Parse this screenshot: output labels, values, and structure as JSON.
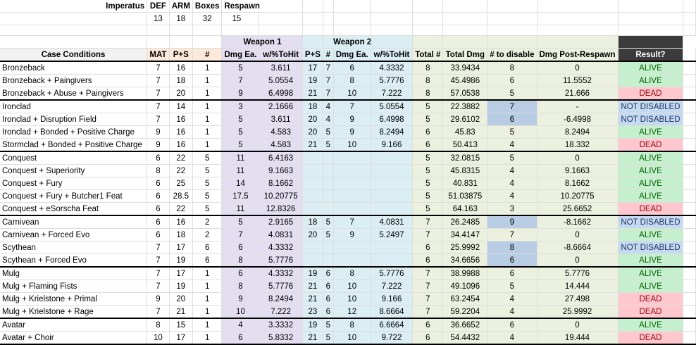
{
  "header_row": {
    "label": "Imperatus",
    "cols": [
      "DEF",
      "ARM",
      "Boxes",
      "Respawn"
    ],
    "vals": [
      "13",
      "18",
      "32",
      "15"
    ]
  },
  "groups": {
    "weapon1": "Weapon 1",
    "weapon2": "Weapon 2"
  },
  "columns": {
    "case": "Case Conditions",
    "mat": "MAT",
    "ps1": "P+S",
    "n1": "#",
    "dmg1": "Dmg Ea.",
    "hit1": "w/%ToHit",
    "ps2": "P+S",
    "n2": "#",
    "dmg2": "Dmg Ea.",
    "hit2": "w/%ToHit",
    "total_n": "Total #",
    "total_dmg": "Total Dmg",
    "to_disable": "# to disable",
    "post": "Dmg Post-Respawn",
    "result": "Result?"
  },
  "rows": [
    {
      "case": "Bronzeback",
      "mat": "7",
      "ps1": "16",
      "n1": "1",
      "dmg1": "5",
      "hit1": "3.611",
      "ps2": "17",
      "n2": "7",
      "dmg2": "6",
      "hit2": "4.3332",
      "tn": "8",
      "td": "33.9434",
      "dis": "8",
      "post": "0",
      "result": "ALIVE"
    },
    {
      "case": "Bronzeback + Paingivers",
      "mat": "7",
      "ps1": "18",
      "n1": "1",
      "dmg1": "7",
      "hit1": "5.0554",
      "ps2": "19",
      "n2": "7",
      "dmg2": "8",
      "hit2": "5.7776",
      "tn": "8",
      "td": "45.4986",
      "dis": "6",
      "post": "11.5552",
      "result": "ALIVE"
    },
    {
      "case": "Bronzeback + Abuse + Paingivers",
      "mat": "7",
      "ps1": "20",
      "n1": "1",
      "dmg1": "9",
      "hit1": "6.4998",
      "ps2": "21",
      "n2": "7",
      "dmg2": "10",
      "hit2": "7.222",
      "tn": "8",
      "td": "57.0538",
      "dis": "5",
      "post": "21.666",
      "result": "DEAD"
    },
    {
      "case": "Ironclad",
      "mat": "7",
      "ps1": "14",
      "n1": "1",
      "dmg1": "3",
      "hit1": "2.1666",
      "ps2": "18",
      "n2": "4",
      "dmg2": "7",
      "hit2": "5.0554",
      "tn": "5",
      "td": "22.3882",
      "dis": "7",
      "post": "-",
      "result": "NOT DISABLED",
      "hl": true
    },
    {
      "case": "Ironclad + Disruption Field",
      "mat": "7",
      "ps1": "16",
      "n1": "1",
      "dmg1": "5",
      "hit1": "3.611",
      "ps2": "20",
      "n2": "4",
      "dmg2": "9",
      "hit2": "6.4998",
      "tn": "5",
      "td": "29.6102",
      "dis": "6",
      "post": "-6.4998",
      "result": "NOT DISABLED",
      "hl": true
    },
    {
      "case": "Ironclad + Bonded + Positive Charge",
      "mat": "9",
      "ps1": "16",
      "n1": "1",
      "dmg1": "5",
      "hit1": "4.583",
      "ps2": "20",
      "n2": "5",
      "dmg2": "9",
      "hit2": "8.2494",
      "tn": "6",
      "td": "45.83",
      "dis": "5",
      "post": "8.2494",
      "result": "ALIVE"
    },
    {
      "case": "Stormclad + Bonded + Positive Charge",
      "mat": "9",
      "ps1": "16",
      "n1": "1",
      "dmg1": "5",
      "hit1": "4.583",
      "ps2": "21",
      "n2": "5",
      "dmg2": "10",
      "hit2": "9.166",
      "tn": "6",
      "td": "50.413",
      "dis": "4",
      "post": "18.332",
      "result": "DEAD"
    },
    {
      "case": "Conquest",
      "mat": "6",
      "ps1": "22",
      "n1": "5",
      "dmg1": "11",
      "hit1": "6.4163",
      "ps2": "",
      "n2": "",
      "dmg2": "",
      "hit2": "",
      "tn": "5",
      "td": "32.0815",
      "dis": "5",
      "post": "0",
      "result": "ALIVE"
    },
    {
      "case": "Conquest + Superiority",
      "mat": "8",
      "ps1": "22",
      "n1": "5",
      "dmg1": "11",
      "hit1": "9.1663",
      "ps2": "",
      "n2": "",
      "dmg2": "",
      "hit2": "",
      "tn": "5",
      "td": "45.8315",
      "dis": "4",
      "post": "9.1663",
      "result": "ALIVE"
    },
    {
      "case": "Conquest + Fury",
      "mat": "6",
      "ps1": "25",
      "n1": "5",
      "dmg1": "14",
      "hit1": "8.1662",
      "ps2": "",
      "n2": "",
      "dmg2": "",
      "hit2": "",
      "tn": "5",
      "td": "40.831",
      "dis": "4",
      "post": "8.1662",
      "result": "ALIVE"
    },
    {
      "case": "Conquest + Fury + Butcher1 Feat",
      "mat": "6",
      "ps1": "28.5",
      "n1": "5",
      "dmg1": "17.5",
      "hit1": "10.20775",
      "ps2": "",
      "n2": "",
      "dmg2": "",
      "hit2": "",
      "tn": "5",
      "td": "51.03875",
      "dis": "4",
      "post": "10.20775",
      "result": "ALIVE"
    },
    {
      "case": "Conquest + eSorscha Feat",
      "mat": "6",
      "ps1": "22",
      "n1": "5",
      "dmg1": "11",
      "hit1": "12.8326",
      "ps2": "",
      "n2": "",
      "dmg2": "",
      "hit2": "",
      "tn": "5",
      "td": "64.163",
      "dis": "3",
      "post": "25.6652",
      "result": "DEAD"
    },
    {
      "case": "Carnivean",
      "mat": "6",
      "ps1": "16",
      "n1": "2",
      "dmg1": "5",
      "hit1": "2.9165",
      "ps2": "18",
      "n2": "5",
      "dmg2": "7",
      "hit2": "4.0831",
      "tn": "7",
      "td": "26.2485",
      "dis": "9",
      "post": "-8.1662",
      "result": "NOT DISABLED",
      "hl": true
    },
    {
      "case": "Carnivean + Forced Evo",
      "mat": "6",
      "ps1": "18",
      "n1": "2",
      "dmg1": "7",
      "hit1": "4.0831",
      "ps2": "20",
      "n2": "5",
      "dmg2": "9",
      "hit2": "5.2497",
      "tn": "7",
      "td": "34.4147",
      "dis": "7",
      "post": "0",
      "result": "ALIVE"
    },
    {
      "case": "Scythean",
      "mat": "7",
      "ps1": "17",
      "n1": "6",
      "dmg1": "6",
      "hit1": "4.3332",
      "ps2": "",
      "n2": "",
      "dmg2": "",
      "hit2": "",
      "tn": "6",
      "td": "25.9992",
      "dis": "8",
      "post": "-8.6664",
      "result": "NOT DISABLED",
      "hl": true
    },
    {
      "case": "Scythean + Forced Evo",
      "mat": "7",
      "ps1": "19",
      "n1": "6",
      "dmg1": "8",
      "hit1": "5.7776",
      "ps2": "",
      "n2": "",
      "dmg2": "",
      "hit2": "",
      "tn": "6",
      "td": "34.6656",
      "dis": "6",
      "post": "0",
      "result": "ALIVE",
      "hl": true
    },
    {
      "case": "Mulg",
      "mat": "7",
      "ps1": "17",
      "n1": "1",
      "dmg1": "6",
      "hit1": "4.3332",
      "ps2": "19",
      "n2": "6",
      "dmg2": "8",
      "hit2": "5.7776",
      "tn": "7",
      "td": "38.9988",
      "dis": "6",
      "post": "5.7776",
      "result": "ALIVE"
    },
    {
      "case": "Mulg + Flaming Fists",
      "mat": "7",
      "ps1": "19",
      "n1": "1",
      "dmg1": "8",
      "hit1": "5.7776",
      "ps2": "21",
      "n2": "6",
      "dmg2": "10",
      "hit2": "7.222",
      "tn": "7",
      "td": "49.1096",
      "dis": "5",
      "post": "14.444",
      "result": "ALIVE"
    },
    {
      "case": "Mulg + Krielstone + Primal",
      "mat": "9",
      "ps1": "20",
      "n1": "1",
      "dmg1": "9",
      "hit1": "8.2494",
      "ps2": "21",
      "n2": "6",
      "dmg2": "10",
      "hit2": "9.166",
      "tn": "7",
      "td": "63.2454",
      "dis": "4",
      "post": "27.498",
      "result": "DEAD"
    },
    {
      "case": "Mulg + Krielstone + Rage",
      "mat": "7",
      "ps1": "21",
      "n1": "1",
      "dmg1": "10",
      "hit1": "7.222",
      "ps2": "23",
      "n2": "6",
      "dmg2": "12",
      "hit2": "8.6664",
      "tn": "7",
      "td": "59.2204",
      "dis": "4",
      "post": "25.9992",
      "result": "DEAD"
    },
    {
      "case": "Avatar",
      "mat": "8",
      "ps1": "15",
      "n1": "1",
      "dmg1": "4",
      "hit1": "3.3332",
      "ps2": "19",
      "n2": "5",
      "dmg2": "8",
      "hit2": "6.6664",
      "tn": "6",
      "td": "36.6652",
      "dis": "6",
      "post": "0",
      "result": "ALIVE"
    },
    {
      "case": "Avatar + Choir",
      "mat": "10",
      "ps1": "17",
      "n1": "1",
      "dmg1": "6",
      "hit1": "5.8332",
      "ps2": "21",
      "n2": "5",
      "dmg2": "10",
      "hit2": "9.722",
      "tn": "6",
      "td": "54.4432",
      "dis": "4",
      "post": "19.444",
      "result": "DEAD"
    }
  ]
}
